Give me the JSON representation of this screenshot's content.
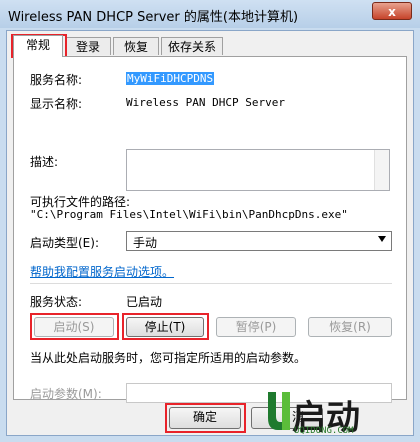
{
  "window": {
    "title": "Wireless PAN DHCP Server 的属性(本地计算机)",
    "close_glyph": "x"
  },
  "tabs": [
    {
      "label": "常规"
    },
    {
      "label": "登录"
    },
    {
      "label": "恢复"
    },
    {
      "label": "依存关系"
    }
  ],
  "general": {
    "service_name_label": "服务名称:",
    "service_name_value": "MyWiFiDHCPDNS",
    "display_name_label": "显示名称:",
    "display_name_value": "Wireless PAN DHCP Server",
    "description_label": "描述:",
    "exe_path_label": "可执行文件的路径:",
    "exe_path_value": "\"C:\\Program Files\\Intel\\WiFi\\bin\\PanDhcpDns.exe\"",
    "startup_type_label": "启动类型(E):",
    "startup_type_value": "手动",
    "help_link": "帮助我配置服务启动选项。",
    "status_label": "服务状态:",
    "status_value": "已启动",
    "start_btn": "启动(S)",
    "stop_btn": "停止(T)",
    "pause_btn": "暂停(P)",
    "resume_btn": "恢复(R)",
    "hint": "当从此处启动服务时，您可指定所适用的启动参数。",
    "params_label": "启动参数(M):",
    "params_value": ""
  },
  "footer": {
    "ok_btn": "确定",
    "cancel_btn_partial": "消"
  },
  "watermark": {
    "text": "启动",
    "site": "UQIDONG.COM"
  },
  "colors": {
    "highlight_red": "#e8232a",
    "link": "#0066cc",
    "selection": "#3399ff"
  }
}
